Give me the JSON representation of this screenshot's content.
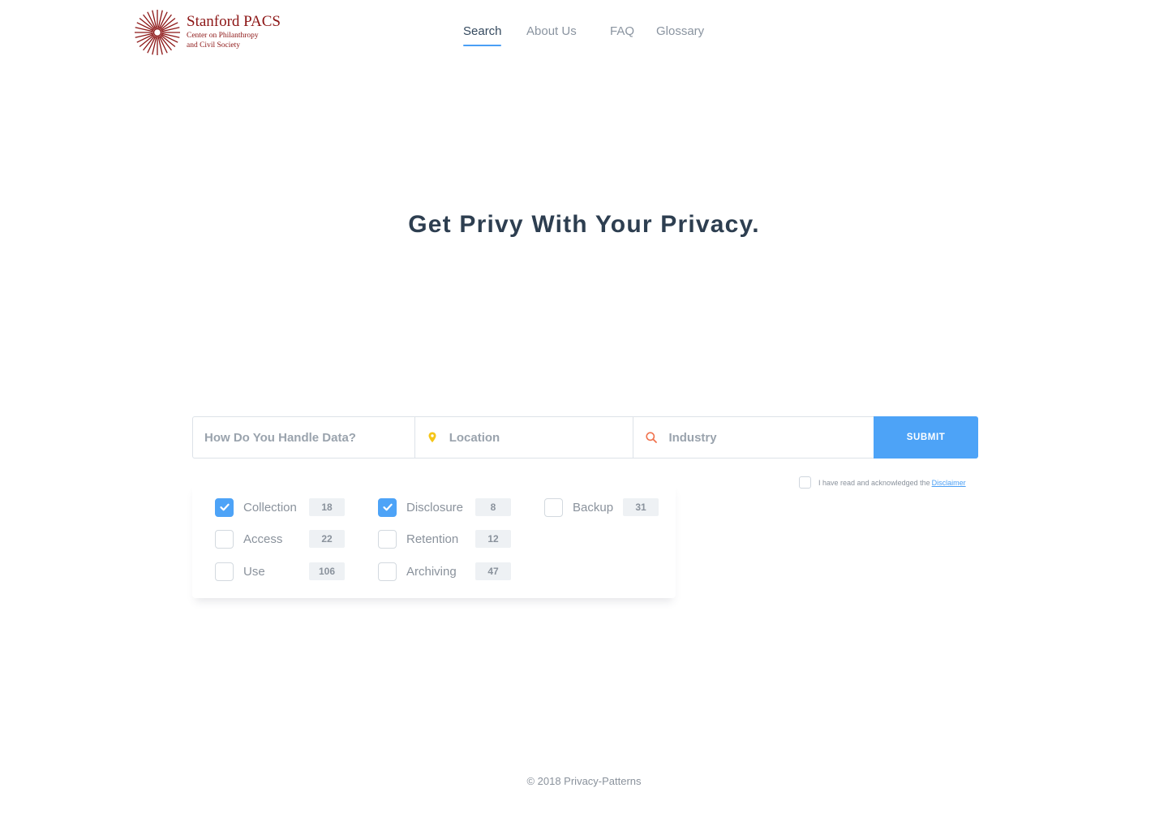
{
  "brand": {
    "title": "Stanford PACS",
    "subtitle_line1": "Center on Philanthropy",
    "subtitle_line2": "and Civil Society",
    "color": "#8c1515",
    "icon": "sunburst-logo-icon"
  },
  "nav": {
    "items": [
      {
        "label": "Search",
        "active": true
      },
      {
        "label": "About Us",
        "active": false
      },
      {
        "label": "FAQ",
        "active": false
      },
      {
        "label": "Glossary",
        "active": false
      }
    ],
    "active_color": "#4a9ff5"
  },
  "hero": {
    "title": "Get Privy With Your Privacy."
  },
  "search": {
    "data_placeholder": "How Do You Handle Data?",
    "location_placeholder": "Location",
    "location_icon": "map-pin-icon",
    "industry_placeholder": "Industry",
    "industry_icon": "search-icon",
    "submit_label": "SUBMIT",
    "accent_color": "#4da3f7"
  },
  "disclaimer": {
    "text": "I have read and acknowledged the",
    "link_text": "Disclaimer",
    "checked": false
  },
  "options": [
    {
      "label": "Collection",
      "count": "18",
      "checked": true
    },
    {
      "label": "Access",
      "count": "22",
      "checked": false
    },
    {
      "label": "Use",
      "count": "106",
      "checked": false
    },
    {
      "label": "Disclosure",
      "count": "8",
      "checked": true
    },
    {
      "label": "Retention",
      "count": "12",
      "checked": false
    },
    {
      "label": "Archiving",
      "count": "47",
      "checked": false
    },
    {
      "label": "Backup",
      "count": "31",
      "checked": false
    }
  ],
  "footer": {
    "text": "© 2018 Privacy-Patterns"
  }
}
